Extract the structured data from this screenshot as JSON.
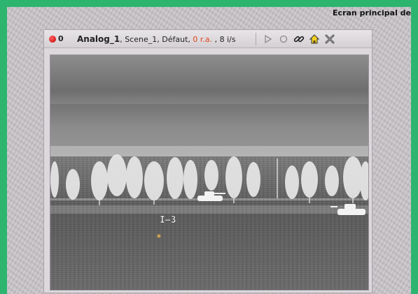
{
  "window": {
    "title": "Ecran principal de"
  },
  "camera": {
    "record_count": "0",
    "name": "Analog_1",
    "details_prefix": ", Scene_1, Défaut, ",
    "status": "0 r.a.",
    "fps": " , 8 i/s"
  },
  "icons": {
    "record": "record-dot-icon",
    "play": "play-icon",
    "circle": "circle-icon",
    "link": "link-icon",
    "home": "home-icon",
    "close": "close-icon"
  },
  "overlay": {
    "marker_label": "I—3"
  },
  "colors": {
    "background": "#2db56f",
    "status": "#e0451f",
    "record": "#d40000"
  }
}
